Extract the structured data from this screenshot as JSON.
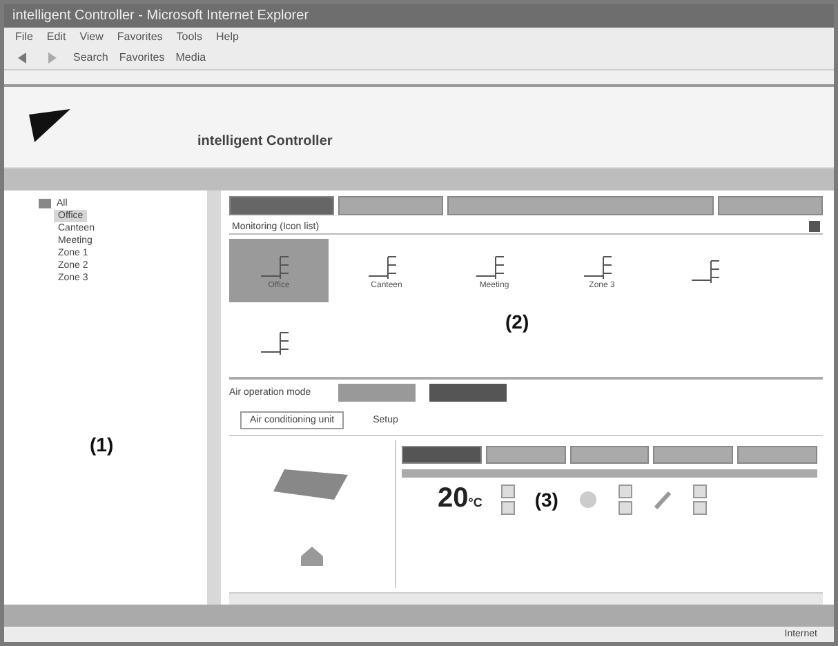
{
  "window": {
    "title": "intelligent Controller - Microsoft Internet Explorer"
  },
  "menu": [
    "File",
    "Edit",
    "View",
    "Favorites",
    "Tools",
    "Help"
  ],
  "toolbar": [
    "Search",
    "Favorites",
    "Media"
  ],
  "header": {
    "brand": "intelligent Controller"
  },
  "tree": {
    "label": "All",
    "children": [
      {
        "label": "Office",
        "selected": true
      },
      {
        "label": "Canteen",
        "selected": false
      },
      {
        "label": "Meeting",
        "selected": false
      },
      {
        "label": "Zone 1",
        "selected": false
      },
      {
        "label": "Zone 2",
        "selected": false
      },
      {
        "label": "Zone 3",
        "selected": false
      }
    ]
  },
  "tabs": [
    {
      "selected": true
    },
    {
      "selected": false
    },
    {
      "selected": false
    },
    {
      "selected": false
    }
  ],
  "monitor": {
    "title": "Monitoring (Icon list)",
    "units": [
      {
        "label": "Office",
        "selected": true
      },
      {
        "label": "Canteen",
        "selected": false
      },
      {
        "label": "Meeting",
        "selected": false
      },
      {
        "label": "Zone 3",
        "selected": false
      },
      {
        "selected": false
      },
      {
        "selected": false
      }
    ]
  },
  "operation": {
    "label": "Air operation mode"
  },
  "unit_tabs": [
    {
      "label": "Air conditioning unit",
      "selected": true
    },
    {
      "label": "Setup",
      "selected": false
    }
  ],
  "modes": [
    {
      "selected": true
    },
    {
      "selected": false
    },
    {
      "selected": false
    },
    {
      "selected": false
    },
    {
      "selected": false
    }
  ],
  "setpoint": {
    "value": "20",
    "unit": "°C"
  },
  "callouts": [
    "(1)",
    "(2)",
    "(3)"
  ],
  "status_bar": {
    "zone": "Internet"
  }
}
